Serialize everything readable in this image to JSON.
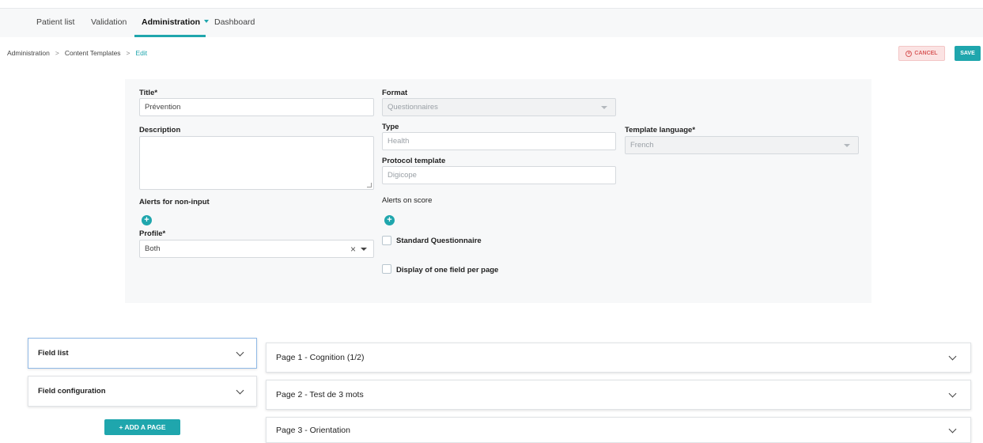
{
  "nav": {
    "items": [
      "Patient list",
      "Validation",
      "Administration",
      "Dashboard"
    ]
  },
  "breadcrumb": {
    "items": [
      "Administration",
      "Content Templates",
      "Edit"
    ]
  },
  "actions": {
    "cancel_label": "CANCEL",
    "save_label": "SAVE"
  },
  "form": {
    "title_label": "Title*",
    "title_value": "Prévention",
    "description_label": "Description",
    "description_value": "",
    "alerts_non_input_label": "Alerts for non-input",
    "profile_label": "Profile*",
    "profile_value": "Both",
    "format_label": "Format",
    "format_value": "Questionnaires",
    "type_label": "Type",
    "type_value": "Health",
    "protocol_label": "Protocol template",
    "protocol_value": "Digicope",
    "alerts_score_label": "Alerts on score",
    "standard_label": "Standard Questionnaire",
    "one_field_label": "Display of one field per page",
    "language_label": "Template language*",
    "language_value": "French"
  },
  "sidebar": {
    "field_list": "Field list",
    "field_config": "Field configuration",
    "add_page_label": "+ ADD A PAGE"
  },
  "pages": [
    "Page 1 - Cognition (1/2)",
    "Page 2 - Test de 3 mots",
    "Page 3 - Orientation"
  ],
  "colors": {
    "accent": "#1fa6ad",
    "cancel": "#d95c5c"
  }
}
